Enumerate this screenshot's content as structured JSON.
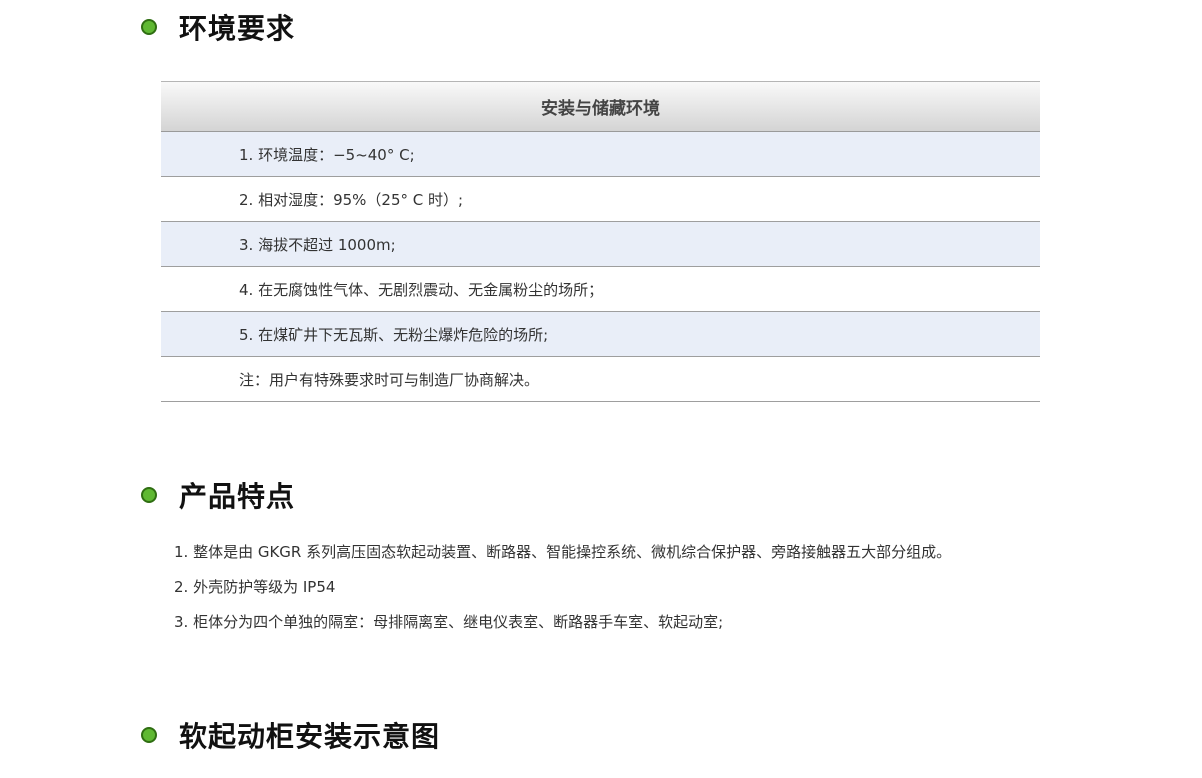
{
  "sections": {
    "environment": {
      "title": "环境要求",
      "table": {
        "header": "安装与储藏环境",
        "rows": [
          "1. 环境温度：−5~40°  C;",
          "2. 相对湿度：95%（25°  C 时）;",
          "3. 海拔不超过 1000m;",
          "4. 在无腐蚀性气体、无剧烈震动、无金属粉尘的场所；",
          "5. 在煤矿井下无瓦斯、无粉尘爆炸危险的场所;",
          "注：用户有特殊要求时可与制造厂协商解决。"
        ]
      }
    },
    "features": {
      "title": "产品特点",
      "items": [
        "1. 整体是由 GKGR 系列高压固态软起动装置、断路器、智能操控系统、微机综合保护器、旁路接触器五大部分组成。",
        "2. 外壳防护等级为 IP54",
        "3. 柜体分为四个单独的隔室：母排隔离室、继电仪表室、断路器手车室、软起动室;"
      ]
    },
    "installation": {
      "title": "软起动柜安装示意图"
    }
  },
  "colors": {
    "bullet_fill": "#5fb832",
    "bullet_border": "#2f6e12",
    "row_shade": "#e9eef8"
  }
}
